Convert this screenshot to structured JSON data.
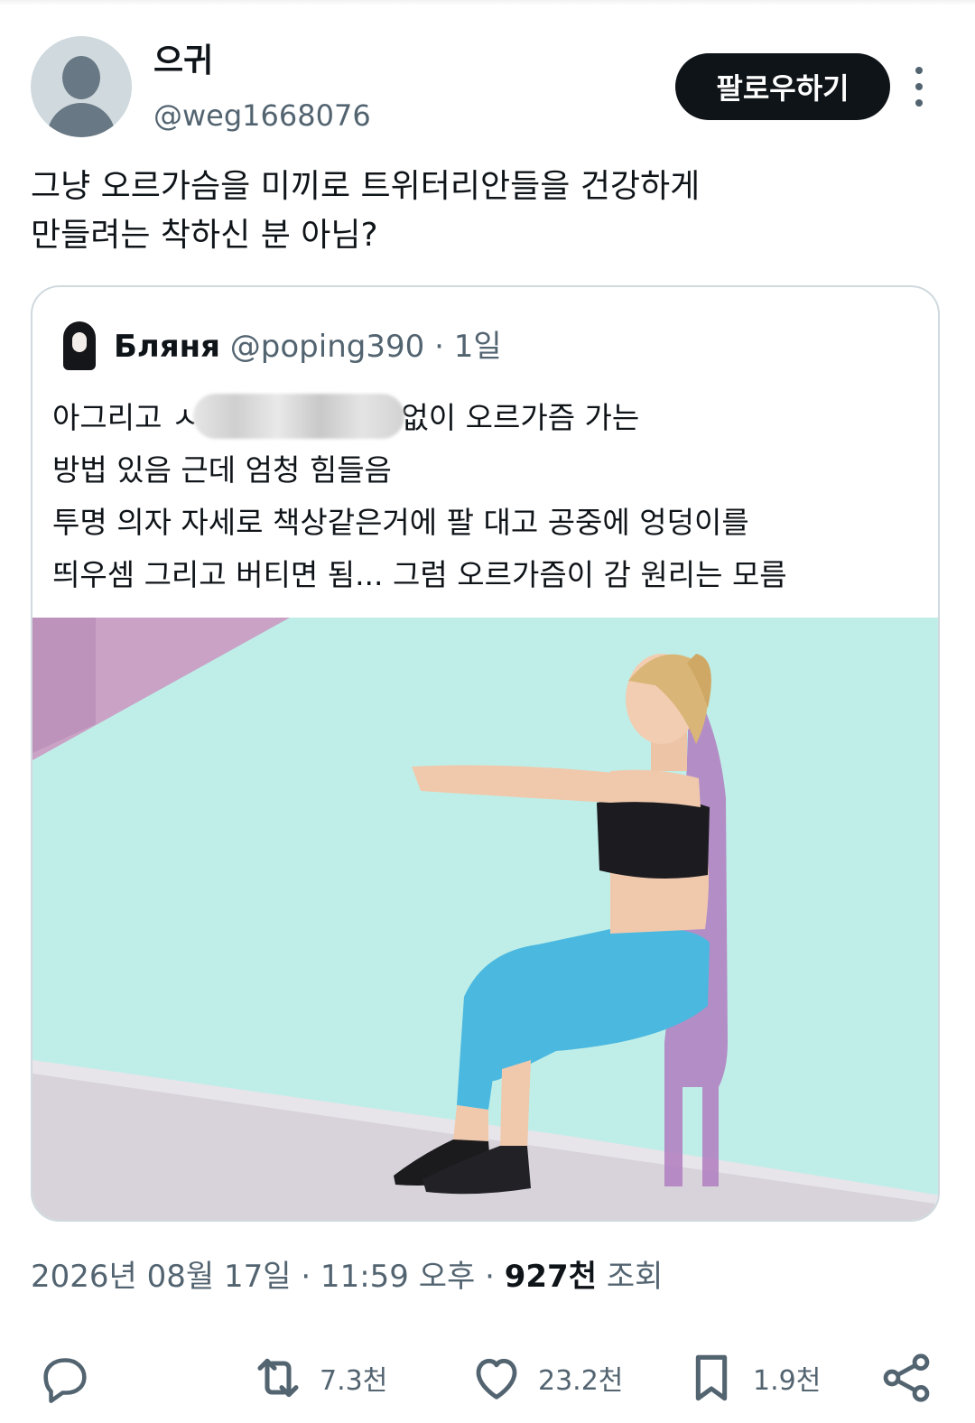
{
  "author": {
    "display_name": "으귀",
    "handle": "@weg1668076"
  },
  "follow_button_label": "팔로우하기",
  "tweet_text": "그냥 오르가슴을 미끼로 트위터리안들을 건강하게\n만들려는 착하신 분 아님?",
  "quoted_tweet": {
    "display_name": "Бляня",
    "handle": "@poping390",
    "separator": "·",
    "time": "1일",
    "text": "아그리고 ㅅ                    터치 진짜 아예 없이 오르가즘 가는\n방법 있음 근데 엄청 힘들음\n투명 의자 자세로 책상같은거에 팔 대고 공중에 엉덩이를\n띄우셈 그리고 버티면 됨... 그럼 오르가즘이 감 원리는 모름"
  },
  "timestamp": {
    "date_time": "2026년 08월 17일 · 11:59 오후",
    "separator": "·",
    "views_count": "927천",
    "views_label": "조회"
  },
  "actions": {
    "reply_count": "",
    "retweet_count": "7.3천",
    "like_count": "23.2천",
    "bookmark_count": "1.9천"
  },
  "colors": {
    "text_primary": "#0f1419",
    "text_secondary": "#536471",
    "border": "#cfd9de",
    "image_background": "#bfeee8",
    "leggings": "#4bb8e0"
  },
  "icons": [
    "avatar-placeholder",
    "more-dots-icon",
    "reply-icon",
    "retweet-icon",
    "like-icon",
    "bookmark-icon",
    "share-icon"
  ]
}
